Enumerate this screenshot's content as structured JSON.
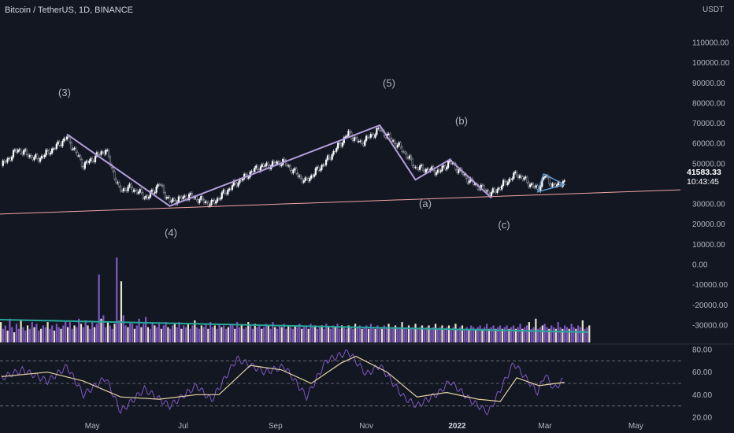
{
  "header": {
    "title": "Bitcoin / TetherUS, 1D, BINANCE",
    "unit": "USDT"
  },
  "last_price": "41583.33",
  "countdown": "10:43:45",
  "colors": {
    "background": "#131722",
    "wave_line": "#b39ddb",
    "trend_line": "#f0a5a5",
    "volume_bar": "#7e57c2",
    "volume_bar_alt": "#e6e3c8",
    "volume_ma": "#26a69a",
    "rsi_line": "#7e57c2",
    "rsi_ma": "#e6d3a3",
    "up_candle": "#ffffff",
    "down_candle": "#1e222d"
  },
  "chart_data": {
    "type": "line",
    "price_axis": {
      "range": [
        -30000,
        110000
      ],
      "ticks": [
        "110000.00",
        "100000.00",
        "90000.00",
        "80000.00",
        "70000.00",
        "60000.00",
        "50000.00",
        "30000.00",
        "20000.00",
        "10000.00",
        "0.00",
        "-10000.00",
        "-20000.00",
        "-30000.00"
      ]
    },
    "rsi_axis": {
      "range": [
        20,
        80
      ],
      "ticks": [
        "80.00",
        "60.00",
        "40.00",
        "20.00"
      ]
    },
    "x_labels": [
      "May",
      "Jul",
      "Sep",
      "Nov",
      "2022",
      "Mar",
      "May"
    ],
    "wave_labels": [
      {
        "text": "(3)"
      },
      {
        "text": "(4)"
      },
      {
        "text": "(5)"
      },
      {
        "text": "(a)"
      },
      {
        "text": "(b)"
      },
      {
        "text": "(c)"
      }
    ],
    "wave_path": [
      {
        "date": "2021-04-14",
        "price": 64500
      },
      {
        "date": "2021-06-22",
        "price": 29000
      },
      {
        "date": "2021-11-10",
        "price": 69000
      },
      {
        "date": "2021-12-04",
        "price": 42000
      },
      {
        "date": "2021-12-27",
        "price": 52000
      },
      {
        "date": "2022-01-24",
        "price": 33000
      }
    ],
    "triangle": [
      {
        "date": "2022-02-28",
        "price": 45000
      },
      {
        "date": "2022-03-14",
        "price": 39500
      },
      {
        "date": "2022-02-24",
        "price": 36000
      }
    ],
    "trend_line": [
      {
        "date": "2021-02-28",
        "price": 25000
      },
      {
        "date": "2022-05-31",
        "price": 37000
      }
    ],
    "price_series": [
      {
        "date": "2021-03-01",
        "price": 49000
      },
      {
        "date": "2021-03-12",
        "price": 57000
      },
      {
        "date": "2021-03-25",
        "price": 52000
      },
      {
        "date": "2021-04-06",
        "price": 58000
      },
      {
        "date": "2021-04-14",
        "price": 63000
      },
      {
        "date": "2021-04-25",
        "price": 49000
      },
      {
        "date": "2021-05-10",
        "price": 57000
      },
      {
        "date": "2021-05-19",
        "price": 37000
      },
      {
        "date": "2021-05-27",
        "price": 38000
      },
      {
        "date": "2021-06-07",
        "price": 33000
      },
      {
        "date": "2021-06-15",
        "price": 40000
      },
      {
        "date": "2021-06-22",
        "price": 31000
      },
      {
        "date": "2021-07-05",
        "price": 34000
      },
      {
        "date": "2021-07-20",
        "price": 30000
      },
      {
        "date": "2021-08-05",
        "price": 40000
      },
      {
        "date": "2021-08-20",
        "price": 48000
      },
      {
        "date": "2021-09-06",
        "price": 51000
      },
      {
        "date": "2021-09-21",
        "price": 41000
      },
      {
        "date": "2021-10-05",
        "price": 51000
      },
      {
        "date": "2021-10-20",
        "price": 65000
      },
      {
        "date": "2021-10-28",
        "price": 60000
      },
      {
        "date": "2021-11-10",
        "price": 67000
      },
      {
        "date": "2021-11-25",
        "price": 57000
      },
      {
        "date": "2021-12-04",
        "price": 48000
      },
      {
        "date": "2021-12-20",
        "price": 46000
      },
      {
        "date": "2021-12-27",
        "price": 51000
      },
      {
        "date": "2022-01-10",
        "price": 41000
      },
      {
        "date": "2022-01-24",
        "price": 35000
      },
      {
        "date": "2022-02-10",
        "price": 45000
      },
      {
        "date": "2022-02-24",
        "price": 37000
      },
      {
        "date": "2022-03-01",
        "price": 44000
      },
      {
        "date": "2022-03-07",
        "price": 38500
      },
      {
        "date": "2022-03-14",
        "price": 41583
      }
    ],
    "volume_series": [
      12,
      8,
      10,
      7,
      14,
      9,
      6,
      11,
      8,
      13,
      9,
      7,
      10,
      8,
      12,
      9,
      11,
      7,
      8,
      10,
      9,
      12,
      8,
      10,
      7,
      11,
      9,
      8,
      10,
      13,
      9,
      12,
      8,
      10,
      9,
      14,
      11,
      9,
      13,
      10,
      8,
      12,
      9,
      11,
      20,
      14,
      16,
      9,
      12,
      10,
      8,
      11,
      25,
      13,
      18,
      16,
      10,
      9,
      12,
      11,
      8,
      10,
      14,
      9,
      11,
      15,
      9,
      8,
      12,
      10,
      9,
      11,
      8,
      10,
      12,
      9,
      8,
      10,
      11,
      9,
      12,
      8,
      10,
      9,
      11,
      8,
      10,
      13,
      9,
      8,
      10,
      9,
      11,
      8,
      12,
      9,
      10,
      8,
      11,
      9,
      10,
      8,
      9,
      11,
      10,
      8,
      12,
      9,
      10,
      8,
      9,
      12,
      10,
      8,
      11,
      9,
      10,
      8,
      9,
      11,
      10,
      8,
      12,
      9,
      8,
      10,
      9,
      11,
      8,
      10,
      9,
      8,
      10,
      9,
      11,
      8,
      9,
      10,
      8,
      11,
      9,
      10,
      8,
      9,
      10,
      8,
      11,
      9,
      8,
      10,
      9,
      11,
      8,
      10,
      9,
      8,
      10,
      9,
      8,
      11,
      9,
      10,
      8,
      9,
      10,
      8,
      11,
      9,
      8,
      10,
      9,
      8,
      10,
      9,
      11,
      8,
      9,
      10,
      8,
      9,
      12,
      8,
      9,
      10,
      8,
      9,
      11,
      8,
      9,
      10,
      8,
      9,
      10,
      8,
      9,
      11,
      8,
      9,
      10,
      8,
      9,
      10,
      8,
      9,
      11,
      8,
      9,
      10,
      8,
      9,
      8,
      10,
      9,
      8,
      9,
      10,
      8,
      9,
      11,
      8,
      9,
      10,
      8,
      9,
      10,
      8,
      9,
      10,
      8,
      9,
      10,
      8,
      9,
      11,
      8,
      9,
      10,
      12,
      8,
      9,
      14,
      8,
      9,
      10,
      11,
      9,
      8,
      10,
      9,
      8,
      12,
      9,
      8,
      10,
      9,
      8,
      11,
      9,
      8,
      10,
      9,
      13,
      8,
      9,
      10
    ],
    "rsi_series": [
      {
        "date": "2021-03-01",
        "value": 55
      },
      {
        "date": "2021-03-15",
        "value": 62
      },
      {
        "date": "2021-04-01",
        "value": 52
      },
      {
        "date": "2021-04-14",
        "value": 65
      },
      {
        "date": "2021-04-25",
        "value": 40
      },
      {
        "date": "2021-05-10",
        "value": 55
      },
      {
        "date": "2021-05-20",
        "value": 25
      },
      {
        "date": "2021-06-05",
        "value": 45
      },
      {
        "date": "2021-06-22",
        "value": 30
      },
      {
        "date": "2021-07-10",
        "value": 48
      },
      {
        "date": "2021-07-20",
        "value": 35
      },
      {
        "date": "2021-08-06",
        "value": 72
      },
      {
        "date": "2021-08-25",
        "value": 60
      },
      {
        "date": "2021-09-07",
        "value": 65
      },
      {
        "date": "2021-09-22",
        "value": 38
      },
      {
        "date": "2021-10-05",
        "value": 70
      },
      {
        "date": "2021-10-20",
        "value": 78
      },
      {
        "date": "2021-11-01",
        "value": 58
      },
      {
        "date": "2021-11-10",
        "value": 66
      },
      {
        "date": "2021-11-26",
        "value": 38
      },
      {
        "date": "2021-12-05",
        "value": 30
      },
      {
        "date": "2021-12-20",
        "value": 42
      },
      {
        "date": "2021-12-27",
        "value": 52
      },
      {
        "date": "2022-01-10",
        "value": 35
      },
      {
        "date": "2022-01-22",
        "value": 24
      },
      {
        "date": "2022-02-08",
        "value": 68
      },
      {
        "date": "2022-02-24",
        "value": 42
      },
      {
        "date": "2022-03-01",
        "value": 58
      },
      {
        "date": "2022-03-07",
        "value": 45
      },
      {
        "date": "2022-03-14",
        "value": 54
      }
    ],
    "rsi_ma_series": [
      {
        "date": "2021-03-01",
        "value": 56
      },
      {
        "date": "2021-04-01",
        "value": 60
      },
      {
        "date": "2021-04-25",
        "value": 52
      },
      {
        "date": "2021-05-20",
        "value": 38
      },
      {
        "date": "2021-06-15",
        "value": 36
      },
      {
        "date": "2021-07-10",
        "value": 40
      },
      {
        "date": "2021-07-25",
        "value": 40
      },
      {
        "date": "2021-08-15",
        "value": 66
      },
      {
        "date": "2021-09-05",
        "value": 62
      },
      {
        "date": "2021-09-25",
        "value": 50
      },
      {
        "date": "2021-10-15",
        "value": 68
      },
      {
        "date": "2021-10-25",
        "value": 74
      },
      {
        "date": "2021-11-15",
        "value": 60
      },
      {
        "date": "2021-12-05",
        "value": 38
      },
      {
        "date": "2021-12-25",
        "value": 42
      },
      {
        "date": "2022-01-15",
        "value": 36
      },
      {
        "date": "2022-01-30",
        "value": 34
      },
      {
        "date": "2022-02-10",
        "value": 55
      },
      {
        "date": "2022-02-25",
        "value": 48
      },
      {
        "date": "2022-03-14",
        "value": 51
      }
    ],
    "grid": false
  }
}
